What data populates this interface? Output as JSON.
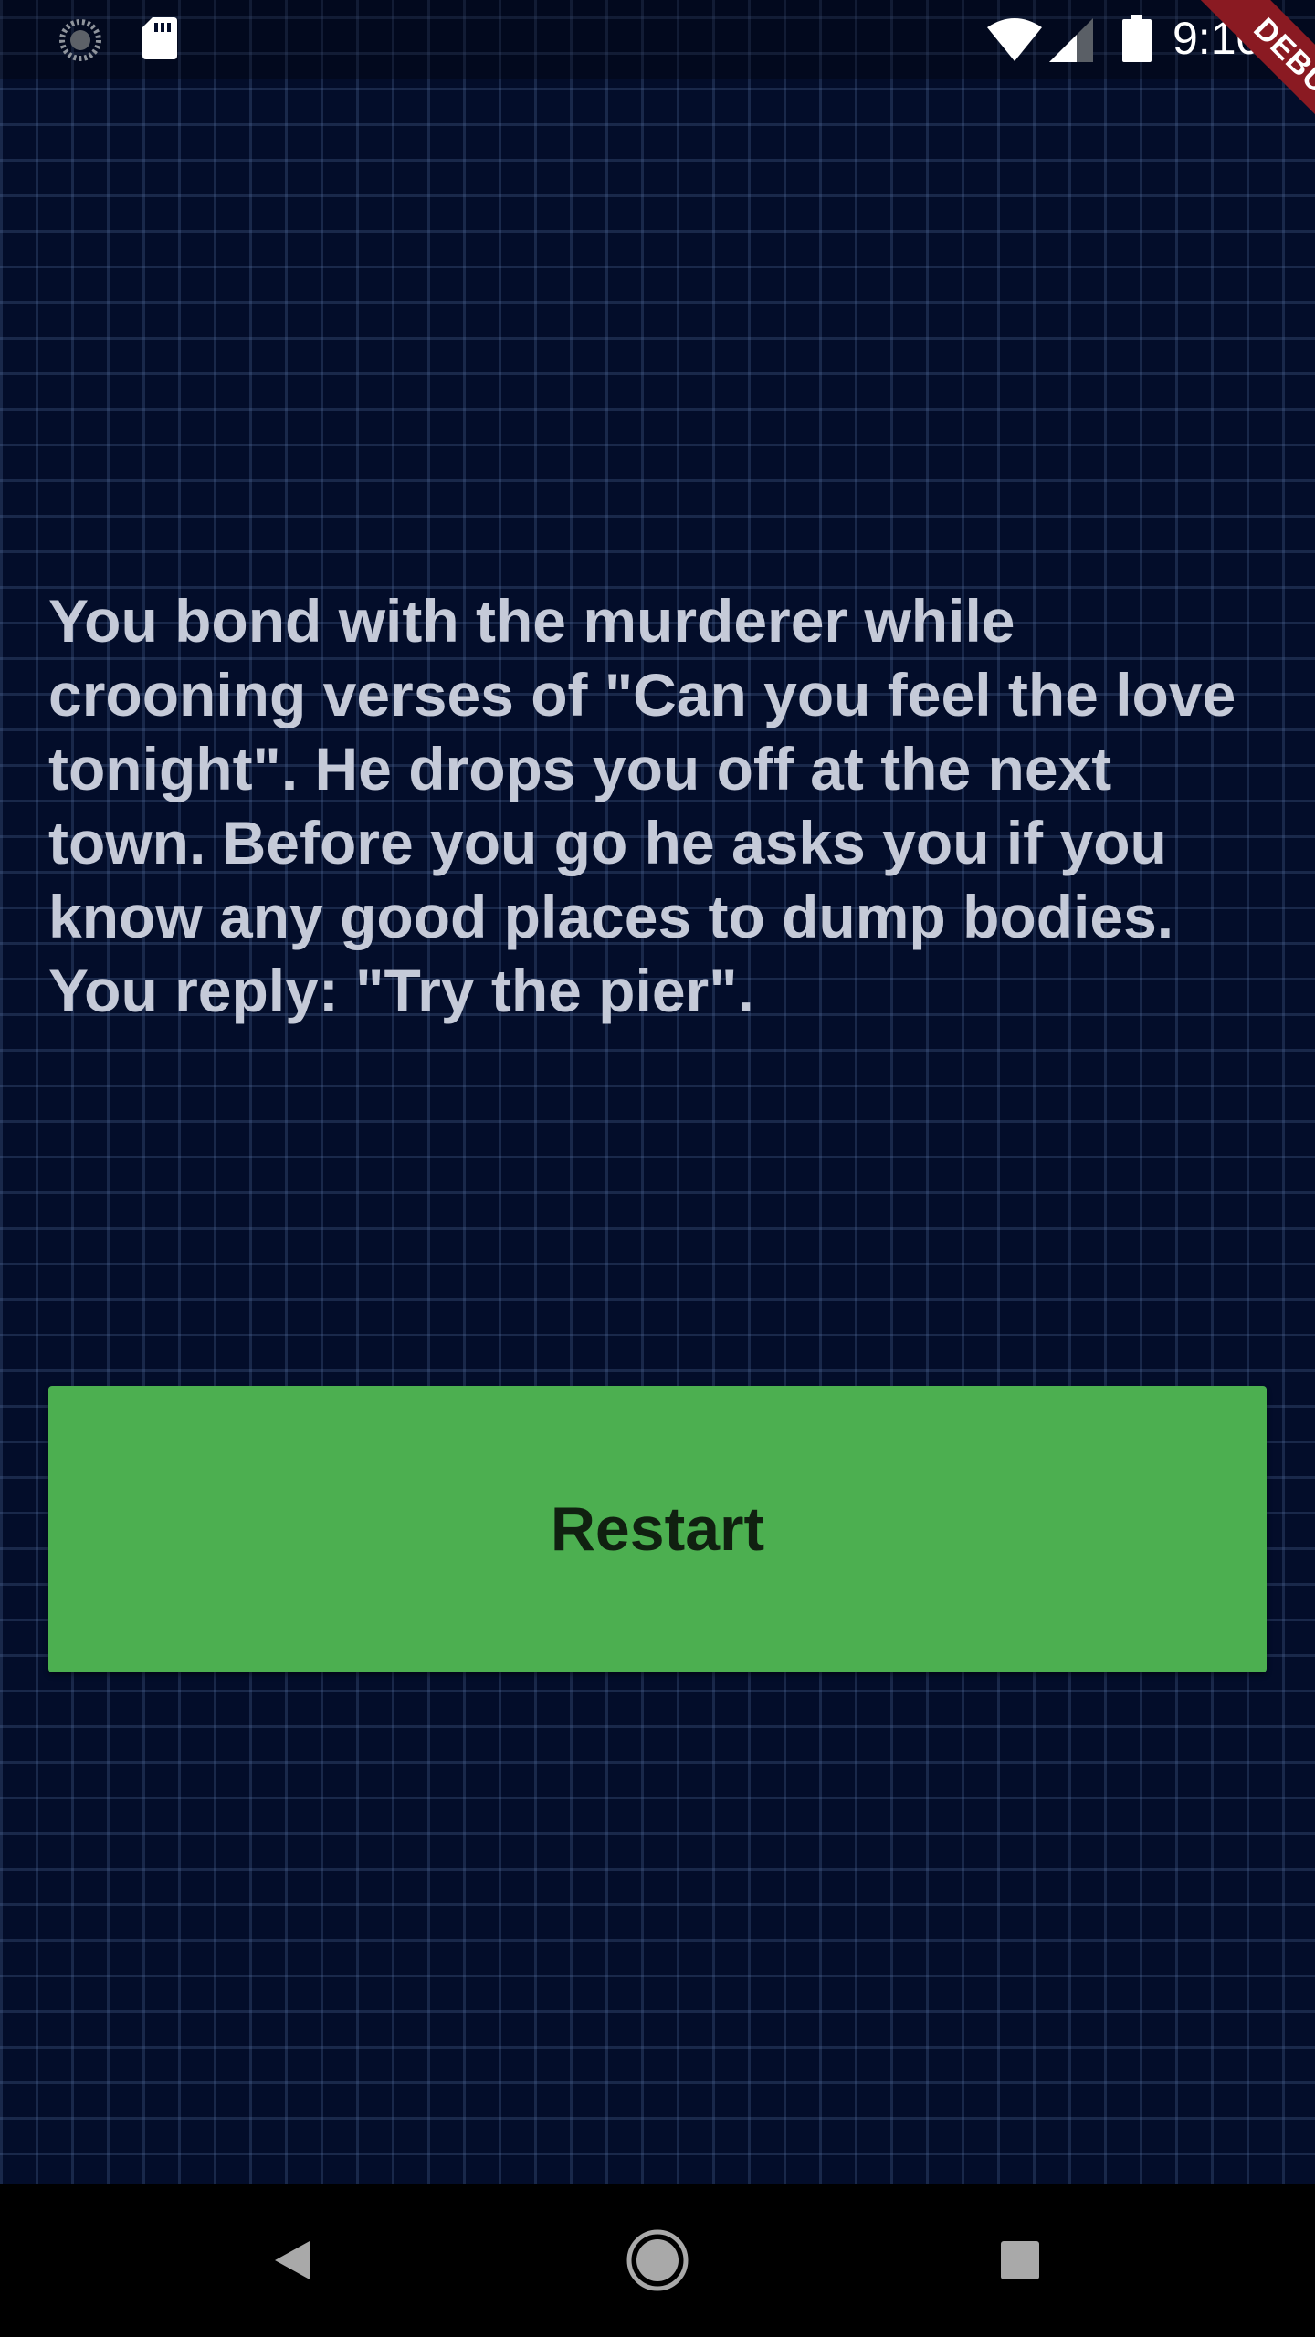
{
  "status_bar": {
    "time": "9:10",
    "icons": [
      "loading-icon",
      "sd-card-icon",
      "wifi-icon",
      "cell-signal-icon",
      "battery-icon"
    ]
  },
  "debug_banner": {
    "label": "DEBUG",
    "color": "#8a1a22"
  },
  "story": {
    "text": "You bond with the murderer while crooning verses of \"Can you feel the love tonight\". He drops you off at the next town. Before you go he asks you if you know any good places to dump bodies. You reply: \"Try the pier\"."
  },
  "restart_button": {
    "label": "Restart",
    "color": "#4caf50"
  },
  "nav_bar": {
    "buttons": [
      "back-icon",
      "home-icon",
      "recents-icon"
    ]
  },
  "colors": {
    "background": "#030d2a",
    "grid": "#5a73a5",
    "text": "#c5cad8"
  }
}
